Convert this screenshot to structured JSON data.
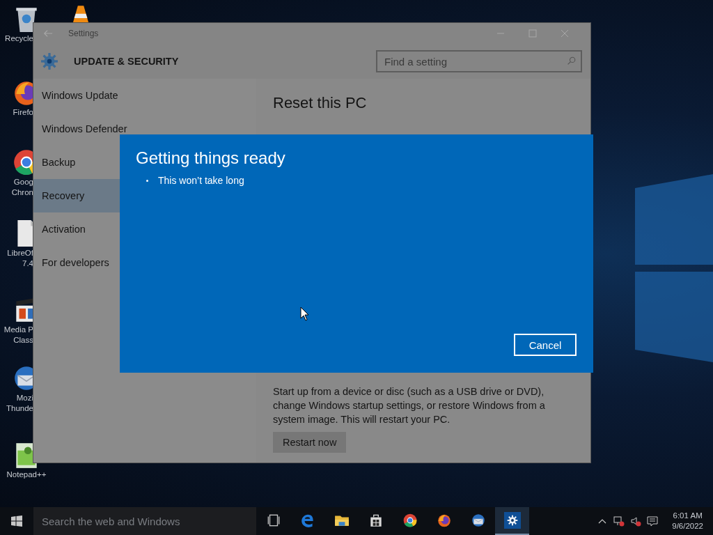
{
  "desktop_icons": [
    {
      "kind": "bin",
      "label": [
        "Recycle"
      ]
    },
    {
      "kind": "cone"
    },
    {
      "kind": "fox",
      "label": [
        "Firefo"
      ]
    },
    {
      "kind": "chrome",
      "label": [
        "Goog",
        "Chron"
      ]
    },
    {
      "kind": "document",
      "label": [
        "LibreOf",
        "7.4"
      ]
    },
    {
      "kind": "clapper",
      "label": [
        "Media P",
        "Class"
      ]
    },
    {
      "kind": "bird",
      "label": [
        "Mozi",
        "Thunde"
      ]
    },
    {
      "kind": "notepad",
      "label": [
        "Notepad++"
      ]
    }
  ],
  "settings_window": {
    "title": "Settings",
    "header": "UPDATE & SECURITY",
    "search": {
      "placeholder": "Find a setting"
    },
    "sidebar": {
      "items": [
        {
          "label": "Windows Update",
          "selected": false
        },
        {
          "label": "Windows Defender",
          "selected": false
        },
        {
          "label": "Backup",
          "selected": false
        },
        {
          "label": "Recovery",
          "selected": true
        },
        {
          "label": "Activation",
          "selected": false
        },
        {
          "label": "For developers",
          "selected": false
        }
      ]
    },
    "content": {
      "title": "Reset this PC",
      "description": "Start up from a device or disc (such as a USB drive or DVD), change Windows startup settings, or restore Windows from a system image. This will restart your PC.",
      "button": "Restart now"
    }
  },
  "dialog": {
    "title": "Getting things ready",
    "bullets": [
      "This won’t take long"
    ],
    "button": "Cancel"
  },
  "taskbar": {
    "search": {
      "placeholder": "Search the web and Windows"
    },
    "apps": [
      {
        "kind": "taskview",
        "selected": false
      },
      {
        "kind": "edge",
        "selected": false
      },
      {
        "kind": "folder",
        "selected": false
      },
      {
        "kind": "store",
        "selected": false
      },
      {
        "kind": "chrome",
        "selected": false
      },
      {
        "kind": "fox",
        "selected": false
      },
      {
        "kind": "bird",
        "selected": false
      },
      {
        "kind": "gear",
        "selected": true
      }
    ],
    "time": "6:01 AM",
    "date": "9/6/2022"
  }
}
